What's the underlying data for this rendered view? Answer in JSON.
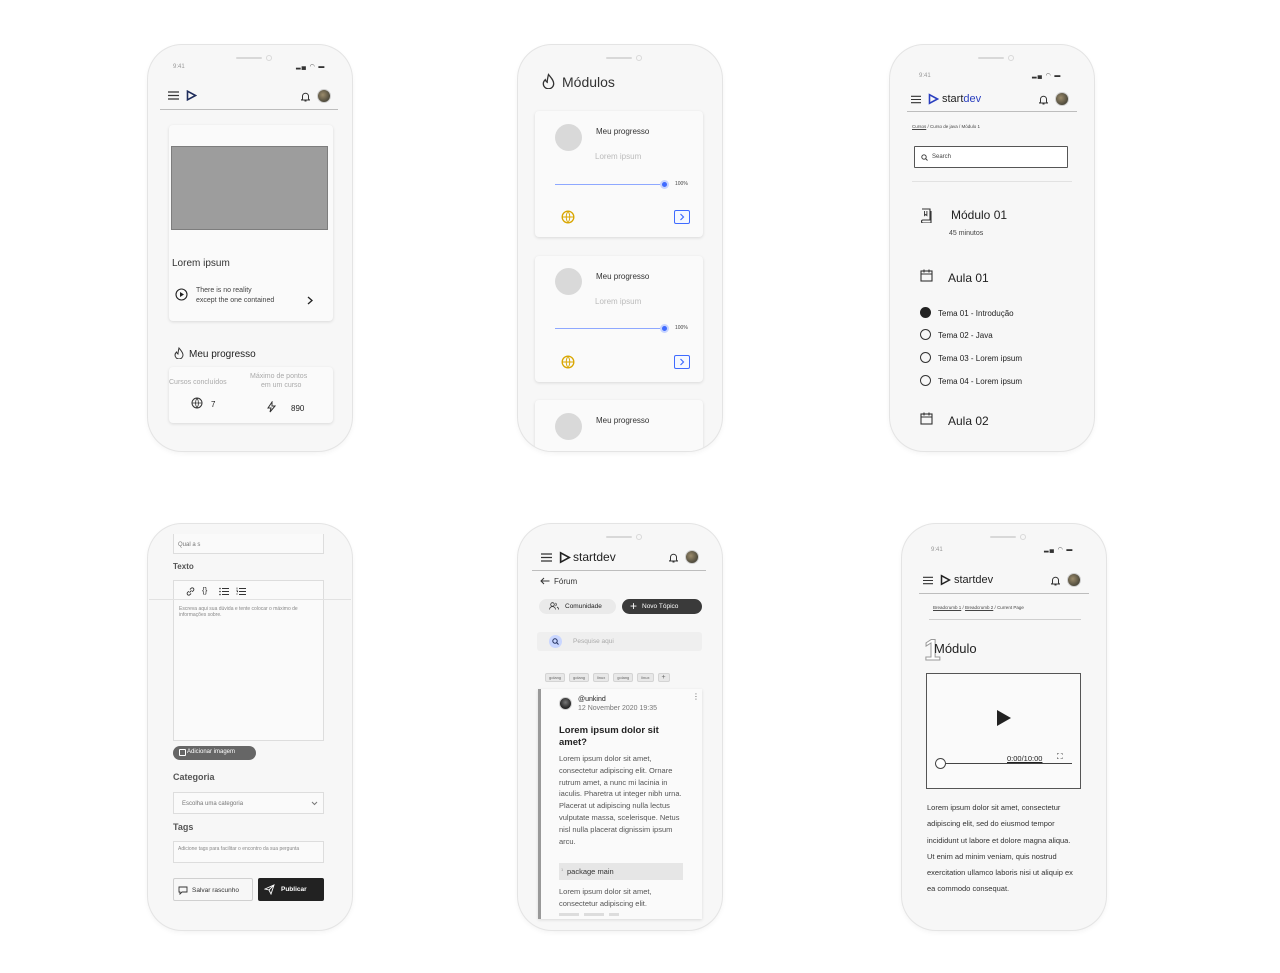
{
  "status": {
    "time": "9:41"
  },
  "phone1": {
    "card_title": "Lorem ipsum",
    "item_line1": "There is no reality",
    "item_line2": "except the one contained",
    "progress_title": "Meu progresso",
    "col1_label": "Cursos concluídos",
    "col2_label_line1": "Máximo de pontos",
    "col2_label_line2": "em um curso",
    "col1_value": "7",
    "col2_value": "890"
  },
  "phone2": {
    "title": "Módulos",
    "cards": [
      {
        "title": "Meu progresso",
        "subtitle": "Lorem ipsum",
        "percent_label": "100%",
        "progress": 1.0
      },
      {
        "title": "Meu progresso",
        "subtitle": "Lorem ipsum",
        "percent_label": "100%",
        "progress": 1.0
      },
      {
        "title": "Meu progresso"
      }
    ]
  },
  "phone3": {
    "brand_a": "start",
    "brand_b": "dev",
    "breadcrumb_link": "Cursos",
    "breadcrumb_rest": " / Curso de java / Módulo 1",
    "search_placeholder": "Search",
    "module_title": "Módulo 01",
    "module_duration": "45 minutos",
    "lesson1": "Aula 01",
    "topics": [
      {
        "label": "Tema 01 - Introdução",
        "done": true
      },
      {
        "label": "Tema 02 - Java",
        "done": false
      },
      {
        "label": "Tema 03 - Lorem ipsum",
        "done": false
      },
      {
        "label": "Tema 04 - Lorem ipsum",
        "done": false
      }
    ],
    "lesson2": "Aula 02"
  },
  "phone4": {
    "question_value": "Qual a s",
    "text_label": "Texto",
    "textarea_placeholder": "Escreva aqui sua dúvida e tente colocar o máximo de informações sobre.",
    "add_image": "Adicionar imagem",
    "category_label": "Categoria",
    "category_placeholder": "Escolha uma categoria",
    "tags_label": "Tags",
    "tags_placeholder": "Adicione tags para facilitar o encontro da sua pergunta",
    "save_draft": "Salvar rascunho",
    "publish": "Publicar"
  },
  "phone5": {
    "brand_a": "start",
    "brand_b": "dev",
    "back_label": "Fórum",
    "community": "Comunidade",
    "new_topic": "Novo Tópico",
    "search_placeholder": "Pesquise aqui",
    "tags": [
      "golang",
      "golang",
      "linux",
      "golang",
      "linux"
    ],
    "post": {
      "user": "@unkind",
      "date": "12 November 2020 19:35",
      "title": "Lorem ipsum dolor sit amet?",
      "body": "Lorem ipsum dolor sit amet, consectetur adipiscing elit. Ornare rutrum amet, a nunc mi lacinia in iaculis. Pharetra ut integer nibh urna. Placerat ut adipiscing nulla lectus vulputate massa, scelerisque. Netus nisl nulla placerat dignissim ipsum arcu.",
      "code": "package main",
      "code_line_no": "1",
      "body2": "Lorem ipsum dolor sit amet, consectetur adipiscing elit."
    }
  },
  "phone6": {
    "brand_a": "start",
    "brand_b": "dev",
    "breadcrumb1": "Breadcrumb 1",
    "breadcrumb2": "Breadcrumb 2",
    "breadcrumb3": "Current Page",
    "module_number": "1",
    "module_title": "Módulo",
    "time_label": "0:00/10:00",
    "video_progress": 0.0,
    "paragraph": "Lorem ipsum dolor sit amet, consectetur adipiscing elit, sed do eiusmod tempor incididunt ut labore et dolore magna aliqua. Ut enim ad minim veniam, quis nostrud exercitation ullamco laboris nisi ut aliquip ex ea commodo consequat."
  }
}
